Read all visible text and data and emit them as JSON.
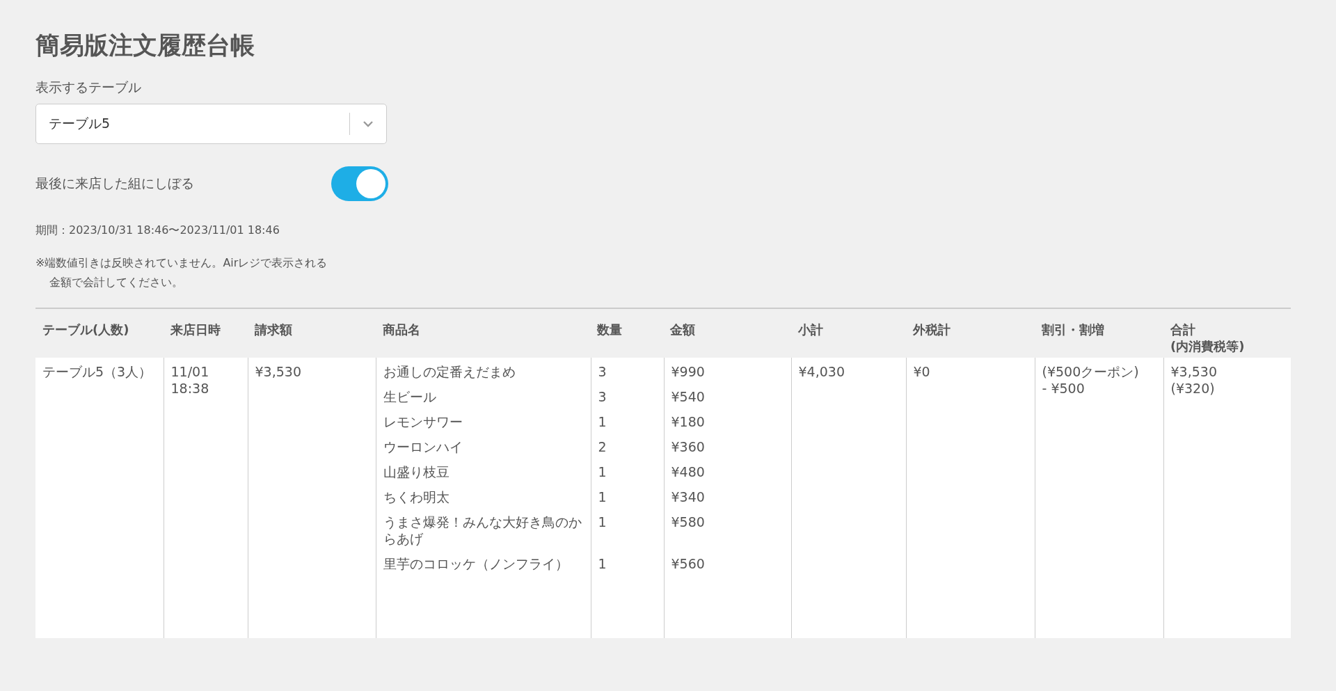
{
  "page": {
    "title": "簡易版注文履歴台帳"
  },
  "table_select": {
    "label": "表示するテーブル",
    "value": "テーブル5"
  },
  "filter": {
    "label": "最後に来店した組にしぼる",
    "on": true
  },
  "period": "期間：2023/10/31 18:46〜2023/11/01 18:46",
  "note": [
    "※端数値引きは反映されていません。Airレジで表示される",
    "金額で会計してください。"
  ],
  "table": {
    "columns": [
      {
        "label": "テーブル(人数)"
      },
      {
        "label": "来店日時"
      },
      {
        "label": "請求額"
      },
      {
        "label": "商品名"
      },
      {
        "label": "数量"
      },
      {
        "label": "金額"
      },
      {
        "label": "小計"
      },
      {
        "label": "外税計"
      },
      {
        "label": "割引・割増"
      },
      {
        "label": "合計",
        "sublabel": "(内消費税等)"
      }
    ],
    "rows": [
      {
        "table": "テーブル5（3人）",
        "visit": [
          "11/01",
          "18:38"
        ],
        "billed": "¥3,530",
        "items": [
          {
            "name": "お通しの定番えだまめ",
            "qty": "3",
            "amount": "¥990"
          },
          {
            "name": "生ビール",
            "qty": "3",
            "amount": "¥540"
          },
          {
            "name": "レモンサワー",
            "qty": "1",
            "amount": "¥180"
          },
          {
            "name": "ウーロンハイ",
            "qty": "2",
            "amount": "¥360"
          },
          {
            "name": "山盛り枝豆",
            "qty": "1",
            "amount": "¥480"
          },
          {
            "name": "ちくわ明太",
            "qty": "1",
            "amount": "¥340"
          },
          {
            "name": "うまさ爆発！みんな大好き鳥のからあげ",
            "qty": "1",
            "amount": "¥580"
          },
          {
            "name": "里芋のコロッケ（ノンフライ）",
            "qty": "1",
            "amount": "¥560"
          }
        ],
        "subtotal": "¥4,030",
        "outer_tax": "¥0",
        "discount": [
          "(¥500クーポン)",
          "- ¥500"
        ],
        "total": [
          "¥3,530",
          "(¥320)"
        ]
      }
    ]
  }
}
